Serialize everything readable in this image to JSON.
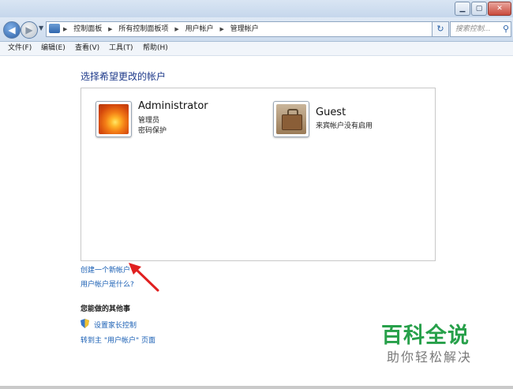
{
  "breadcrumb": [
    "控制面板",
    "所有控制面板项",
    "用户帐户",
    "管理帐户"
  ],
  "search": {
    "placeholder": "搜索控制..."
  },
  "menu": [
    "文件(F)",
    "编辑(E)",
    "查看(V)",
    "工具(T)",
    "帮助(H)"
  ],
  "page": {
    "title": "选择希望更改的帐户"
  },
  "accounts": [
    {
      "name": "Administrator",
      "lines": [
        "管理员",
        "密码保护"
      ],
      "picture_icon": "orange-flower-icon"
    },
    {
      "name": "Guest",
      "lines": [
        "来宾帐户没有启用"
      ],
      "picture_icon": "briefcase-icon"
    }
  ],
  "links": {
    "create_account": "创建一个新帐户",
    "what_is_account": "用户帐户是什么?"
  },
  "other_tasks": {
    "title": "您能做的其他事",
    "parental_controls": "设置家长控制",
    "goto_user_accounts": "转到主 \"用户帐户\" 页面"
  },
  "watermark": {
    "main": "百科全说",
    "sub": "助你轻松解决"
  },
  "colors": {
    "link": "#1a5fb4",
    "title": "#1e3a8a",
    "watermark": "#27a04a",
    "arrow": "#e02020"
  }
}
